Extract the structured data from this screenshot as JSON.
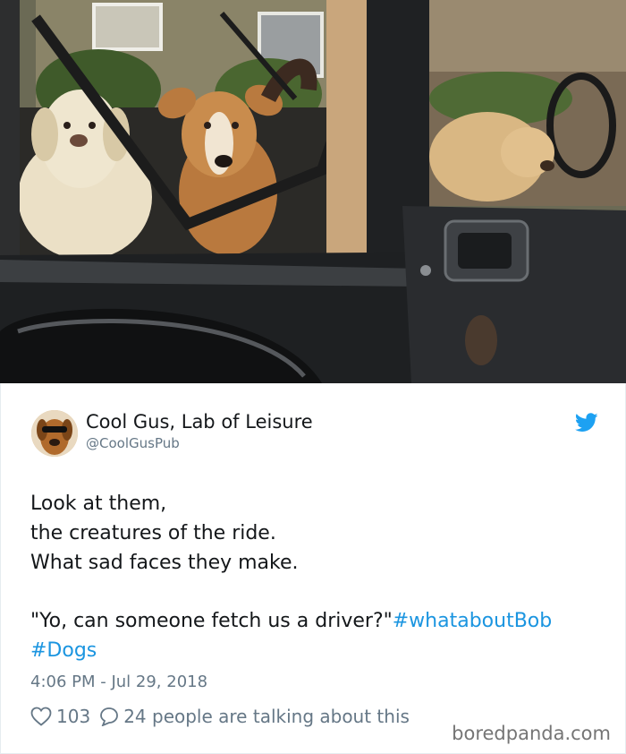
{
  "photo": {
    "subject": "dogs-in-jeep-photo"
  },
  "tweet": {
    "display_name": "Cool Gus, Lab of Leisure",
    "handle": "@CoolGusPub",
    "text_lines": [
      "Look at them,",
      "the creatures of the ride.",
      "What sad faces they make."
    ],
    "quote_text": "\"Yo, can someone fetch us a driver?\"",
    "hashtag_1": "#whataboutBob",
    "hashtag_2": "#Dogs",
    "timestamp": "4:06 PM - Jul 29, 2018",
    "likes": "103",
    "replies_text": "24 people are talking about this",
    "icons": {
      "avatar": "avatar-dog-icon",
      "brand": "twitter-bird-icon",
      "like": "heart-icon",
      "reply": "reply-bubble-icon"
    },
    "colors": {
      "hashtag": "#1b95e0",
      "muted": "#657786",
      "twitter_blue": "#1da1f2"
    }
  },
  "watermark": "boredpanda.com"
}
